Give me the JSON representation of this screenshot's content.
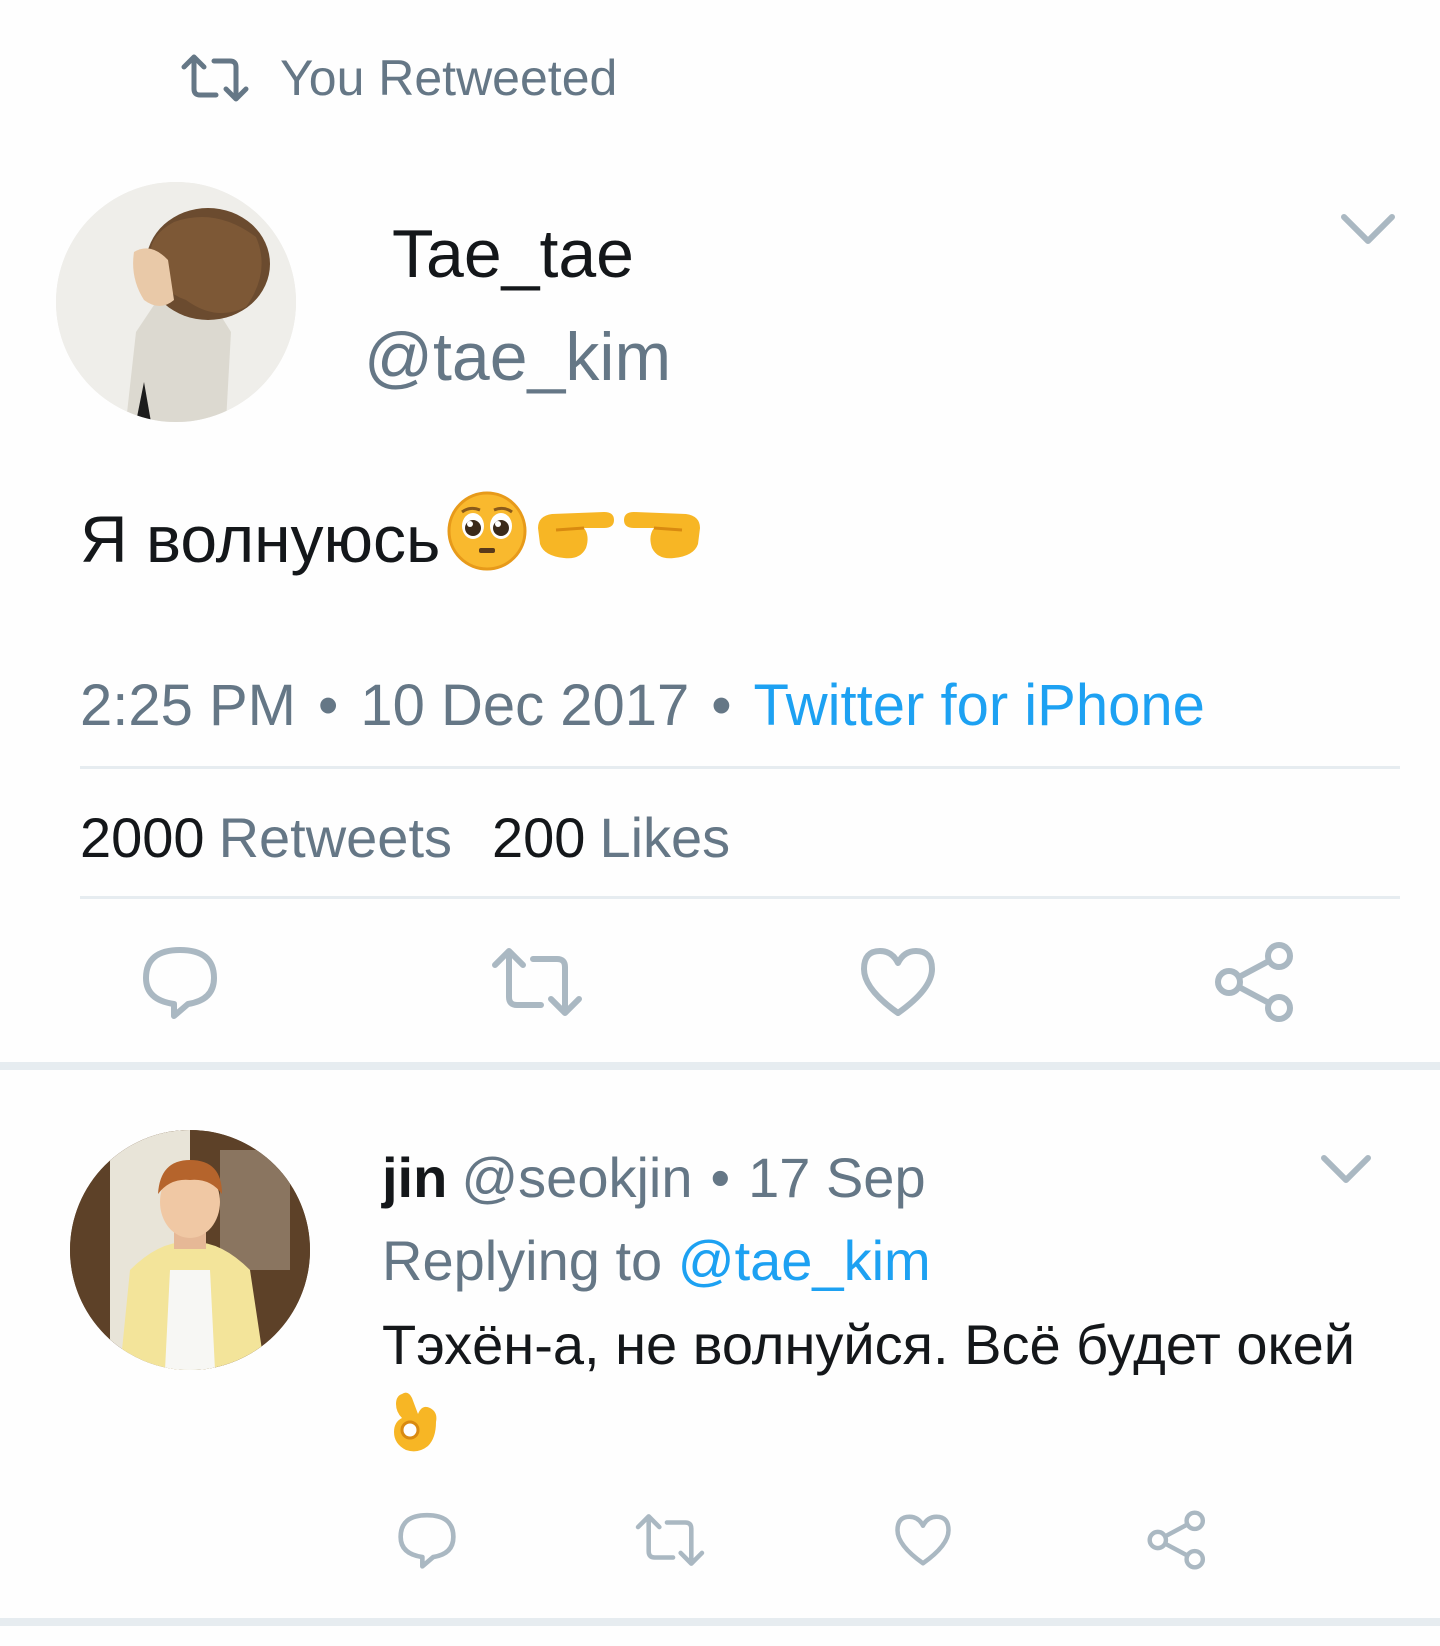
{
  "retweet_header": {
    "label": "You Retweeted",
    "icon": "retweet-icon"
  },
  "main_tweet": {
    "display_name": "Tae_tae",
    "handle": "@tae_kim",
    "text": "Я волнуюсь",
    "emojis": [
      "pleading-face",
      "pointing-right",
      "pointing-left"
    ],
    "time": "2:25 PM",
    "date": "10 Dec 2017",
    "source": "Twitter for iPhone",
    "retweets_count": "2000",
    "retweets_label": "Retweets",
    "likes_count": "200",
    "likes_label": "Likes"
  },
  "reply_tweet": {
    "display_name": "jin",
    "handle": "@seokjin",
    "date": "17 Sep",
    "replying_prefix": "Replying to",
    "replying_handle": "@tae_kim",
    "text": "Тэхён-а, не волнуйся. Всё будет окей",
    "emoji": "ok-hand"
  },
  "colors": {
    "text": "#14171a",
    "muted": "#657786",
    "link": "#1da1f2",
    "divider": "#e6ecf0",
    "icon": "#aab8c2"
  }
}
